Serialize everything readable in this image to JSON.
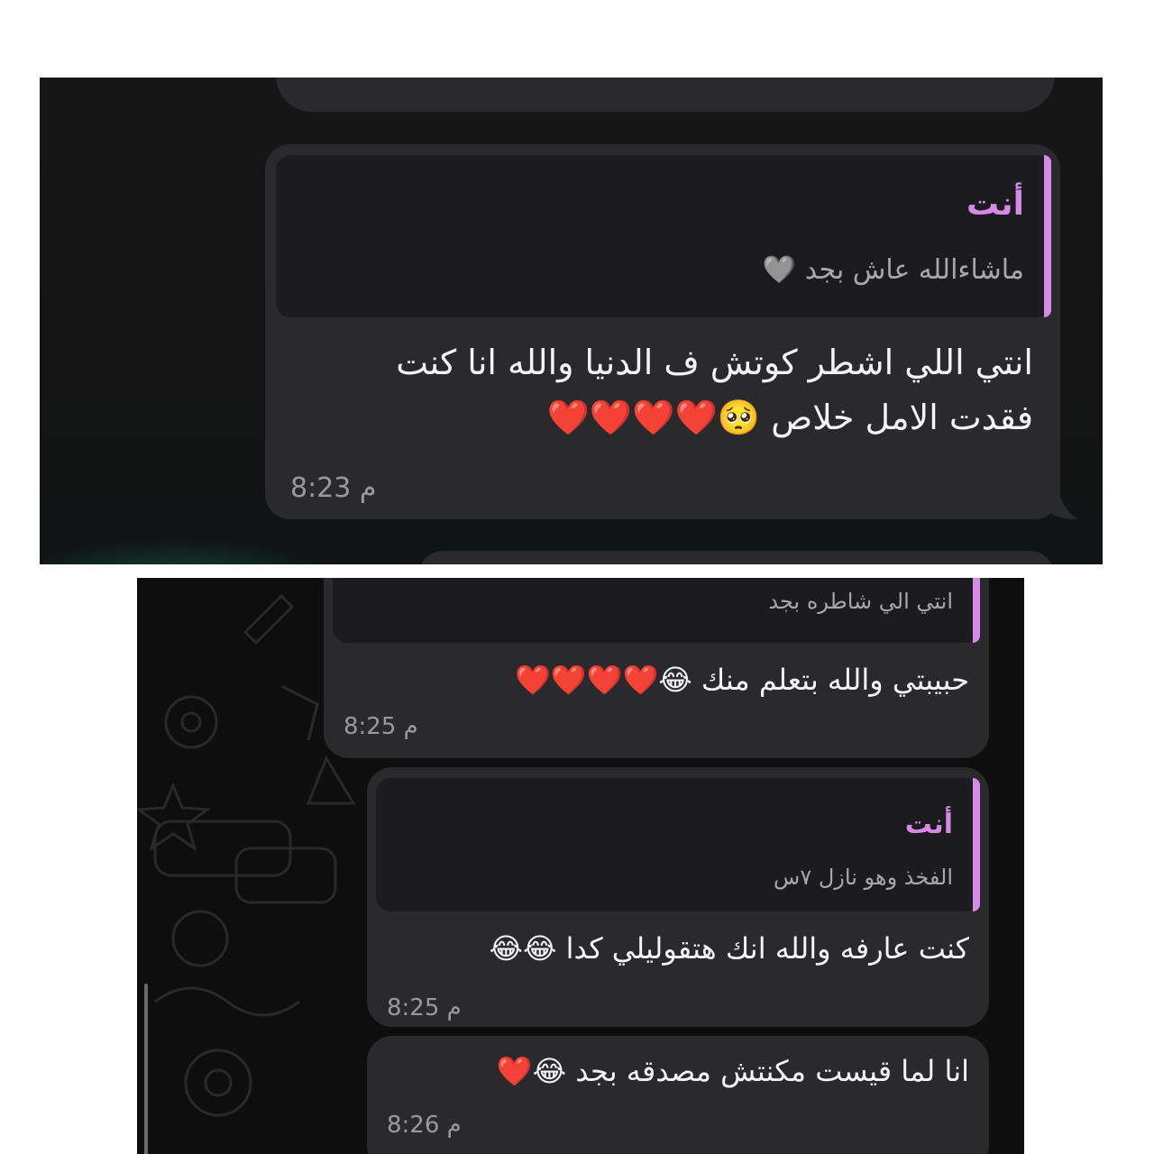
{
  "screenshot_top": {
    "quote": {
      "name": "أنت",
      "text": "ماشاءالله عاش بجد",
      "emoji": "🩶"
    },
    "message": {
      "line1": "انتي اللي اشطر كوتش ف الدنيا والله انا كنت",
      "line2": "فقدت الامل خلاص",
      "emojis": "🥺❤️❤️❤️❤️"
    },
    "time": "8:23 م"
  },
  "screenshot_bottom": {
    "msg1": {
      "quote_text": "انتي الي شاطره بجد",
      "text": "حبيبتي والله بتعلم منك",
      "emojis": "😂❤️❤️❤️❤️",
      "time": "8:25 م"
    },
    "msg2": {
      "quote": {
        "name": "أنت",
        "text": "الفخذ وهو نازل ٧س"
      },
      "text": "كنت عارفه والله انك هتقوليلي كدا",
      "emojis": "😂😂",
      "time": "8:25 م"
    },
    "msg3": {
      "text": "انا لما قيست مكنتش مصدقه بجد",
      "emojis": "😂❤️",
      "time": "8:26 م"
    }
  },
  "colors": {
    "bubble": "#2a2a2c",
    "quote_bg": "#1c1c1e",
    "quote_accent": "#d58ae6",
    "time": "#9a9a9c"
  }
}
